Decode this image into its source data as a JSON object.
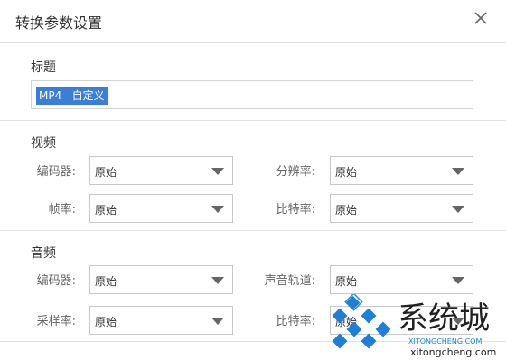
{
  "dialog": {
    "title": "转换参数设置",
    "close_icon": "close-icon"
  },
  "title_section": {
    "label": "标题",
    "input_value": "MP4   自定义"
  },
  "video": {
    "label": "视频",
    "codec_label": "编码器:",
    "codec_value": "原始",
    "resolution_label": "分辨率:",
    "resolution_value": "原始",
    "framerate_label": "帧率:",
    "framerate_value": "原始",
    "bitrate_label": "比特率:",
    "bitrate_value": "原始"
  },
  "audio": {
    "label": "音频",
    "codec_label": "编码器:",
    "codec_value": "原始",
    "channels_label": "声音轨道:",
    "channels_value": "原始",
    "samplerate_label": "采样率:",
    "samplerate_value": "原始",
    "bitrate_label": "比特率:",
    "bitrate_value": "原始"
  },
  "watermark": {
    "text": "系统城",
    "url": "XITONGCHENG.COM",
    "domain": "xitongcheng.com",
    "colors": {
      "blue": "#1e7fd6",
      "dark": "#222222"
    }
  }
}
